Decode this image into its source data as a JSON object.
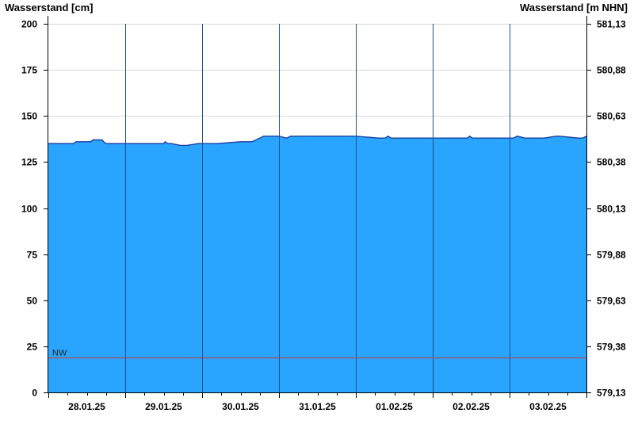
{
  "chart_data": {
    "type": "area",
    "ylabel_left": "Wasserstand [cm]",
    "ylabel_right": "Wasserstand [m NHN]",
    "ylim": [
      0,
      200
    ],
    "yticks_left": [
      "0",
      "25",
      "50",
      "75",
      "100",
      "125",
      "150",
      "175",
      "200"
    ],
    "yticks_right": [
      "579,13",
      "579,38",
      "579,63",
      "579,88",
      "580,13",
      "580,38",
      "580,63",
      "580,88",
      "581,13"
    ],
    "x_day_labels": [
      "28.01.25",
      "29.01.25",
      "30.01.25",
      "31.01.25",
      "01.02.25",
      "02.02.25",
      "03.02.25"
    ],
    "x_range_days": [
      0,
      7
    ],
    "grid": "horizontal",
    "reference_line": {
      "label": "NW",
      "value": 19,
      "color": "#cc3333"
    },
    "series": [
      {
        "color": "#2aa5ff",
        "line_color": "#1a3fa0",
        "x": [
          0.0,
          0.1,
          0.33,
          0.36,
          0.55,
          0.58,
          0.7,
          0.72,
          0.75,
          0.78,
          0.9,
          1.0,
          1.2,
          1.45,
          1.5,
          1.52,
          1.55,
          1.58,
          1.6,
          1.72,
          1.75,
          1.8,
          1.95,
          2.0,
          2.2,
          2.5,
          2.55,
          2.65,
          2.7,
          2.75,
          2.8,
          2.9,
          3.0,
          3.1,
          3.15,
          3.18,
          3.22,
          3.5,
          3.8,
          4.0,
          4.3,
          4.33,
          4.38,
          4.42,
          4.46,
          4.5,
          4.8,
          5.0,
          5.2,
          5.45,
          5.48,
          5.52,
          5.6,
          6.0,
          6.05,
          6.1,
          6.2,
          6.4,
          6.45,
          6.6,
          6.65,
          6.9,
          6.95,
          7.0
        ],
        "y": [
          135,
          135,
          135,
          136,
          136,
          137,
          137,
          136,
          135,
          135,
          135,
          135,
          135,
          135,
          135,
          136,
          135,
          135,
          135,
          134,
          134,
          134,
          135,
          135,
          135,
          136,
          136,
          136,
          137,
          138,
          139,
          139,
          139,
          138,
          139,
          139,
          139,
          139,
          139,
          139,
          138,
          138,
          138,
          139,
          138,
          138,
          138,
          138,
          138,
          138,
          139,
          138,
          138,
          138,
          138,
          139,
          138,
          138,
          138,
          139,
          139,
          138,
          138,
          139
        ]
      }
    ]
  }
}
